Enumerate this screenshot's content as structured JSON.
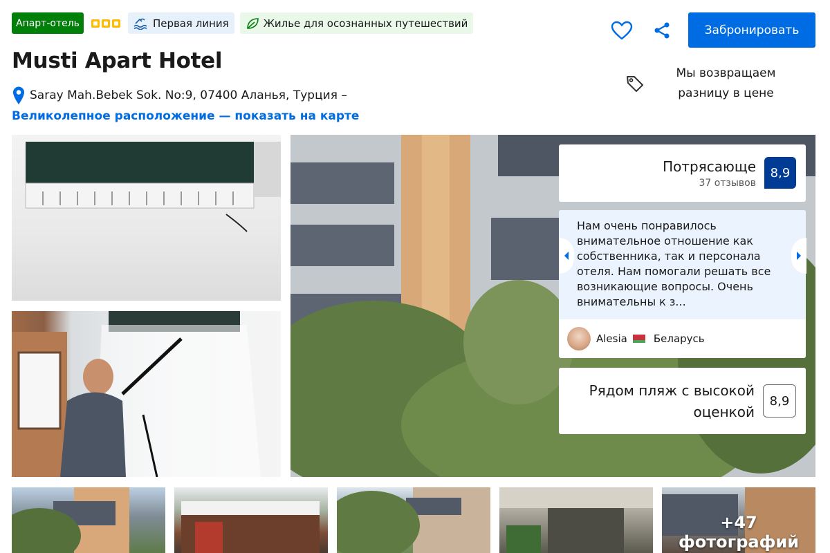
{
  "header": {
    "property_type": "Апарт-отель",
    "star_count": 3,
    "beach_badge": "Первая линия",
    "eco_badge": "Жилье для осознанных путешествий"
  },
  "actions": {
    "favorite_icon": "heart-icon",
    "share_icon": "share-icon",
    "book_label": "Забронировать"
  },
  "hotel": {
    "name": "Musti Apart Hotel",
    "address": "Saray Mah.Bebek Sok. No:9, 07400 Аланья, Турция –",
    "map_link": "Великолепное расположение — показать на карте"
  },
  "price_match": {
    "icon": "price-tag-icon",
    "text": "Мы возвращаем разницу в цене"
  },
  "review_score": {
    "word": "Потрясающе",
    "count": "37 отзывов",
    "score": "8,9"
  },
  "review": {
    "text": "Нам очень понравилось внимательное отношение как собственника, так и персонала отеля. Нам помогали решать все возникающие вопросы. Очень внимательны к з...",
    "author": "Alesia",
    "country": "Беларусь"
  },
  "beach": {
    "text": "Рядом пляж с высокой оценкой",
    "score": "8,9"
  },
  "gallery": {
    "more_photos": "+47 фотографий"
  },
  "colors": {
    "brand_blue": "#006ce4",
    "score_blue": "#003b95",
    "green": "#008009",
    "star_yellow": "#febb02"
  }
}
